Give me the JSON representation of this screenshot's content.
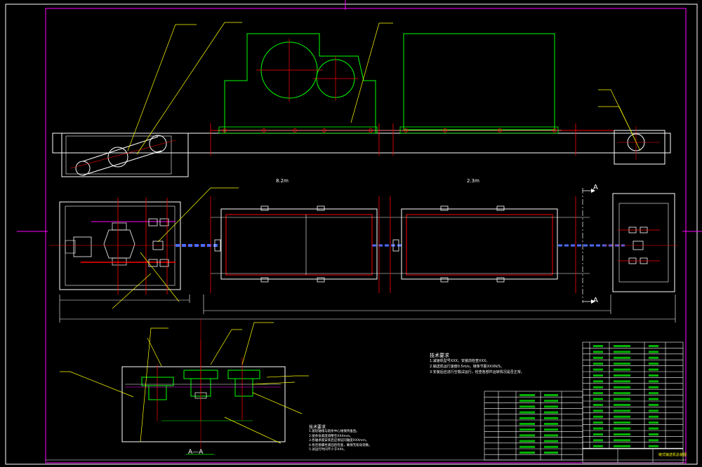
{
  "drawing": {
    "colors": {
      "frame": "#ffffff",
      "outline": "#ffffff",
      "centerline": "#ff0000",
      "green": "#00ff00",
      "yellow": "#ffff00",
      "magenta": "#ff00ff",
      "blue": "#4a6cff",
      "cyan": "#00ffff",
      "background": "#000000"
    },
    "section_labels": {
      "section_a_top": "A",
      "section_a_bottom": "A",
      "section_view": "A—A"
    },
    "top_view_labels": {
      "length_left": "8.2m",
      "length_right": "2.3m"
    },
    "tech_requirements_1": {
      "title": "技术要求",
      "lines": [
        "1.减速机型号XXX，安装前检查XXX。",
        "2.输送机运行速度0.5m/s，链条节距XXXN/S。",
        "3.安装后应进行空载试运行，检查各部件运转情况是否正常。"
      ]
    },
    "tech_requirements_2": {
      "title": "技术要求",
      "lines": [
        "1.链轮轴线与链条中心线保持垂直。",
        "2.链条张紧度调整至XXXmm。",
        "3.各轴承座安装后应保证同轴度XXXmm。",
        "4.各连接螺栓紧固后检查，确保无松动现象。",
        "5.试运行时间不少于XXh。"
      ]
    },
    "title_block": {
      "title": "链式输送机总装图"
    }
  }
}
